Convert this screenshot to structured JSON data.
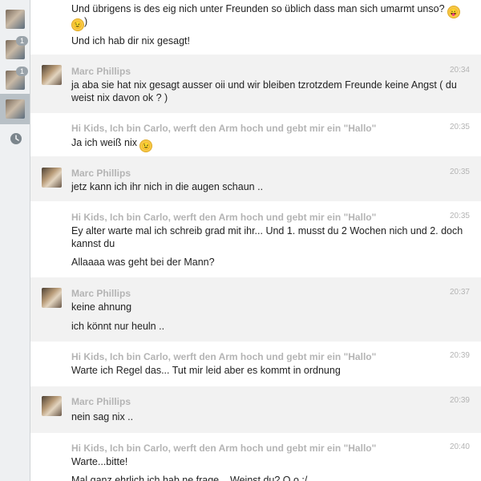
{
  "sidebar": {
    "badges": [
      "1",
      "1"
    ]
  },
  "messages": [
    {
      "lines": [
        "Und übrigens is des eig nich unter Freunden so üblich dass man sich umarmt unso?",
        ")",
        "Und ich hab dir nix gesagt!"
      ]
    },
    {
      "name": "Marc Phillips",
      "time": "20:34",
      "lines": [
        "ja aba sie hat nix gesagt ausser oii und wir bleiben tzrotzdem Freunde keine Angst ( du weist nix davon ok ? )"
      ]
    },
    {
      "name": "Hi Kids, Ich bin Carlo, werft den Arm hoch und gebt mir ein \"Hallo\"",
      "time": "20:35",
      "lines": [
        "Ja ich weiß nix"
      ]
    },
    {
      "name": "Marc Phillips",
      "time": "20:35",
      "lines": [
        "jetz kann ich ihr nich in die augen schaun .."
      ]
    },
    {
      "name": "Hi Kids, Ich bin Carlo, werft den Arm hoch und gebt mir ein \"Hallo\"",
      "time": "20:35",
      "lines": [
        "Ey alter warte mal ich schreib grad mit ihr... Und 1. musst du 2 Wochen nich und 2. doch kannst du",
        "Allaaaa was geht bei der Mann?"
      ]
    },
    {
      "name": "Marc Phillips",
      "time": "20:37",
      "lines": [
        "keine ahnung",
        "ich könnt nur heuln .."
      ]
    },
    {
      "name": "Hi Kids, Ich bin Carlo, werft den Arm hoch und gebt mir ein \"Hallo\"",
      "time": "20:39",
      "lines": [
        "Warte ich Regel das... Tut mir leid aber es kommt in ordnung"
      ]
    },
    {
      "name": "Marc Phillips",
      "time": "20:39",
      "lines": [
        "nein sag nix .."
      ]
    },
    {
      "name": "Hi Kids, Ich bin Carlo, werft den Arm hoch und gebt mir ein \"Hallo\"",
      "time": "20:40",
      "lines": [
        "Warte...bitte!",
        "Mal ganz ehrlich ich hab ne frage... Weinst du? O.o :/"
      ]
    }
  ],
  "emoji": {
    "tongue": "😛",
    "wink": "😉"
  }
}
